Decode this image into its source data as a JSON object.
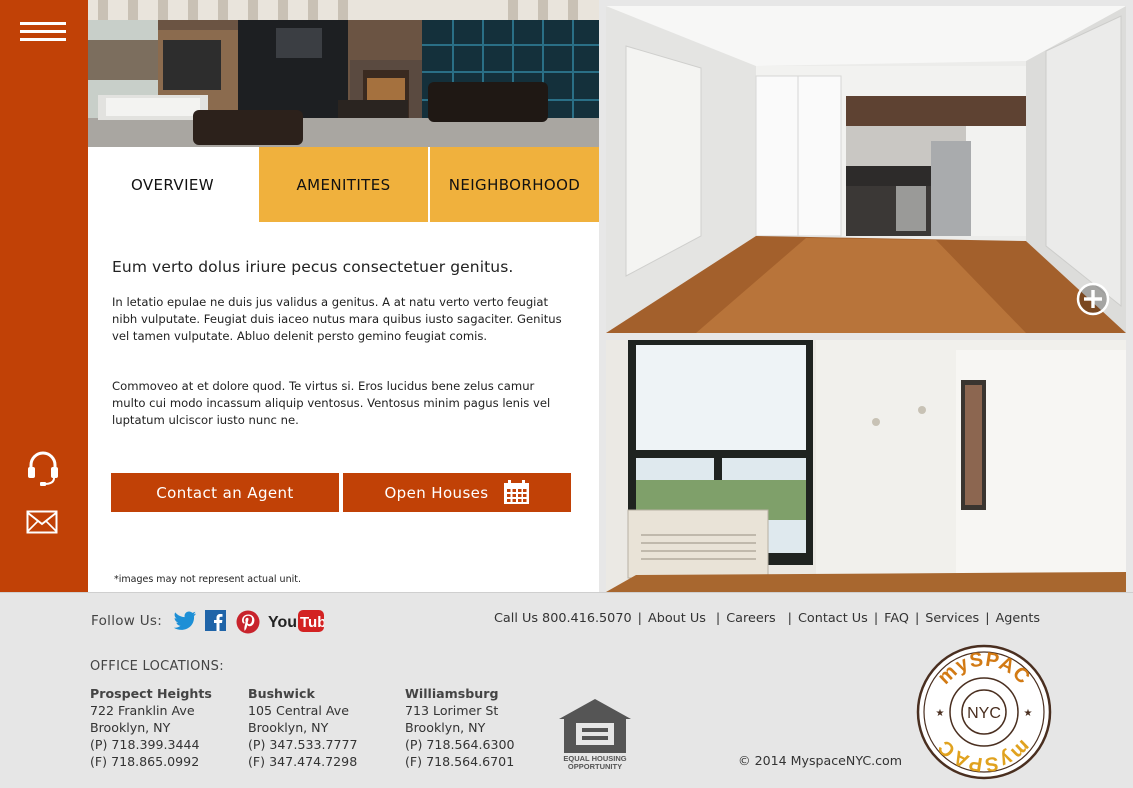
{
  "tabs": [
    {
      "label": "OVERVIEW",
      "active": true
    },
    {
      "label": "AMENITITES",
      "active": false
    },
    {
      "label": "NEIGHBORHOOD",
      "active": false
    }
  ],
  "overview": {
    "headline": "Eum verto dolus iriure pecus consectetuer genitus.",
    "paragraph1": "In letatio epulae ne duis jus validus a genitus. A at natu verto verto feugiat nibh vulputate. Feugiat duis iaceo nutus mara quibus iusto sagaciter. Genitus vel tamen vulputate. Abluo delenit persto gemino feugiat comis.",
    "paragraph2": "Commoveo at et dolore quod. Te virtus si. Eros lucidus bene zelus camur multo cui modo incassum aliquip ventosus. Ventosus minim pagus lenis vel luptatum ulciscor iusto nunc ne.",
    "contact_button": "Contact an Agent",
    "open_houses_button": "Open Houses",
    "disclaimer": "*images may not represent actual unit."
  },
  "icons": {
    "menu": "hamburger-menu-icon",
    "support": "headset-icon",
    "mail": "envelope-icon",
    "zoom": "plus-circle-icon",
    "calendar": "calendar-icon"
  },
  "colors": {
    "brand": "#c14106",
    "tab_inactive": "#f0b13d",
    "footer_bg": "#e6e6e6"
  },
  "footer": {
    "follow_label": "Follow Us:",
    "nav": {
      "call": "Call Us 800.416.5070",
      "about": "About Us",
      "careers": "Careers",
      "contact": "Contact Us",
      "faq": "FAQ",
      "services": "Services",
      "agents": "Agents"
    },
    "offices_title": "OFFICE LOCATIONS:",
    "offices": [
      {
        "name": "Prospect Heights",
        "street": "722 Franklin Ave",
        "city": "Brooklyn, NY",
        "phone": "(P) 718.399.3444",
        "fax": "(F) 718.865.0992"
      },
      {
        "name": "Bushwick",
        "street": "105 Central Ave",
        "city": "Brooklyn, NY",
        "phone": "(P) 347.533.7777",
        "fax": "(F) 347.474.7298"
      },
      {
        "name": "Williamsburg",
        "street": "713 Lorimer St",
        "city": "Brooklyn, NY",
        "phone": "(P) 718.564.6300",
        "fax": "(F) 718.564.6701"
      }
    ],
    "eho_line1": "EQUAL HOUSING",
    "eho_line2": "OPPORTUNITY",
    "copyright": "© 2014 MyspaceNYC.com",
    "logo_text_top": "mySPAC",
    "logo_text_bottom": "mySPAC",
    "logo_center": "NYC"
  }
}
